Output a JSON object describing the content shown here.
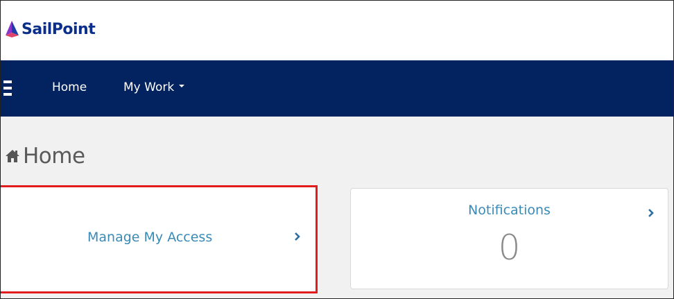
{
  "brand": {
    "logo_text": "SailPoint",
    "logo_color": "#0a2e8a"
  },
  "nav": {
    "menu_icon": "hamburger-icon",
    "items": [
      {
        "label": "Home"
      },
      {
        "label": "My Work",
        "icon": "caret-down-icon"
      }
    ],
    "background": "#032260"
  },
  "page": {
    "title_icon": "home-icon",
    "title": "Home"
  },
  "cards": {
    "manage_access": {
      "label": "Manage My Access",
      "icon": "chevron-right-icon",
      "highlight_color": "#e21c1c"
    },
    "notifications": {
      "label": "Notifications",
      "count": "0",
      "icon": "chevron-right-icon"
    }
  },
  "colors": {
    "link": "#3a8ab6",
    "page_bg": "#f1f1f2"
  }
}
